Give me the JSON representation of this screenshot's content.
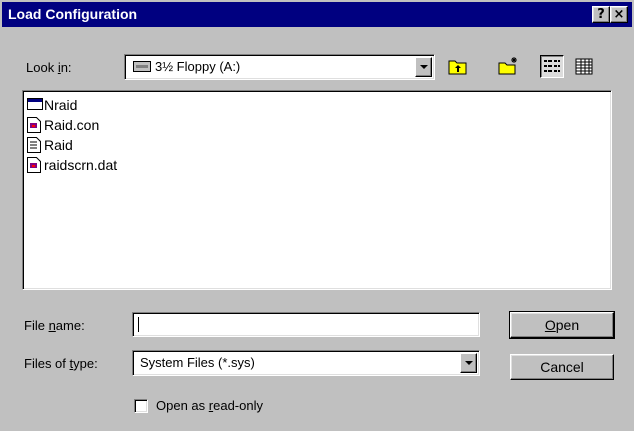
{
  "window": {
    "title": "Load Configuration",
    "help_label": "?",
    "close_label": "×"
  },
  "look_in": {
    "label_pre": "Look ",
    "label_key": "i",
    "label_post": "n:",
    "value": "3½ Floppy (A:)"
  },
  "toolbar": {
    "buttons": [
      "up-one-level",
      "create-new-folder",
      "list-view",
      "details-view"
    ]
  },
  "files": [
    {
      "name": "Nraid",
      "icon": "application-window-icon"
    },
    {
      "name": "Raid.con",
      "icon": "system-file-icon"
    },
    {
      "name": "Raid",
      "icon": "text-document-icon"
    },
    {
      "name": "raidscrn.dat",
      "icon": "system-file-icon"
    }
  ],
  "file_name": {
    "label_pre": "File ",
    "label_key": "n",
    "label_post": "ame:",
    "value": ""
  },
  "files_of_type": {
    "label_pre": "Files of ",
    "label_key": "t",
    "label_post": "ype:",
    "value": "System Files (*.sys)"
  },
  "buttons": {
    "open_key": "O",
    "open_rest": "pen",
    "cancel": "Cancel"
  },
  "read_only": {
    "label_pre": "Open as ",
    "label_key": "r",
    "label_post": "ead-only",
    "checked": false
  },
  "colors": {
    "title_bar": "#000080",
    "dialog_bg": "#c0c0c0"
  }
}
